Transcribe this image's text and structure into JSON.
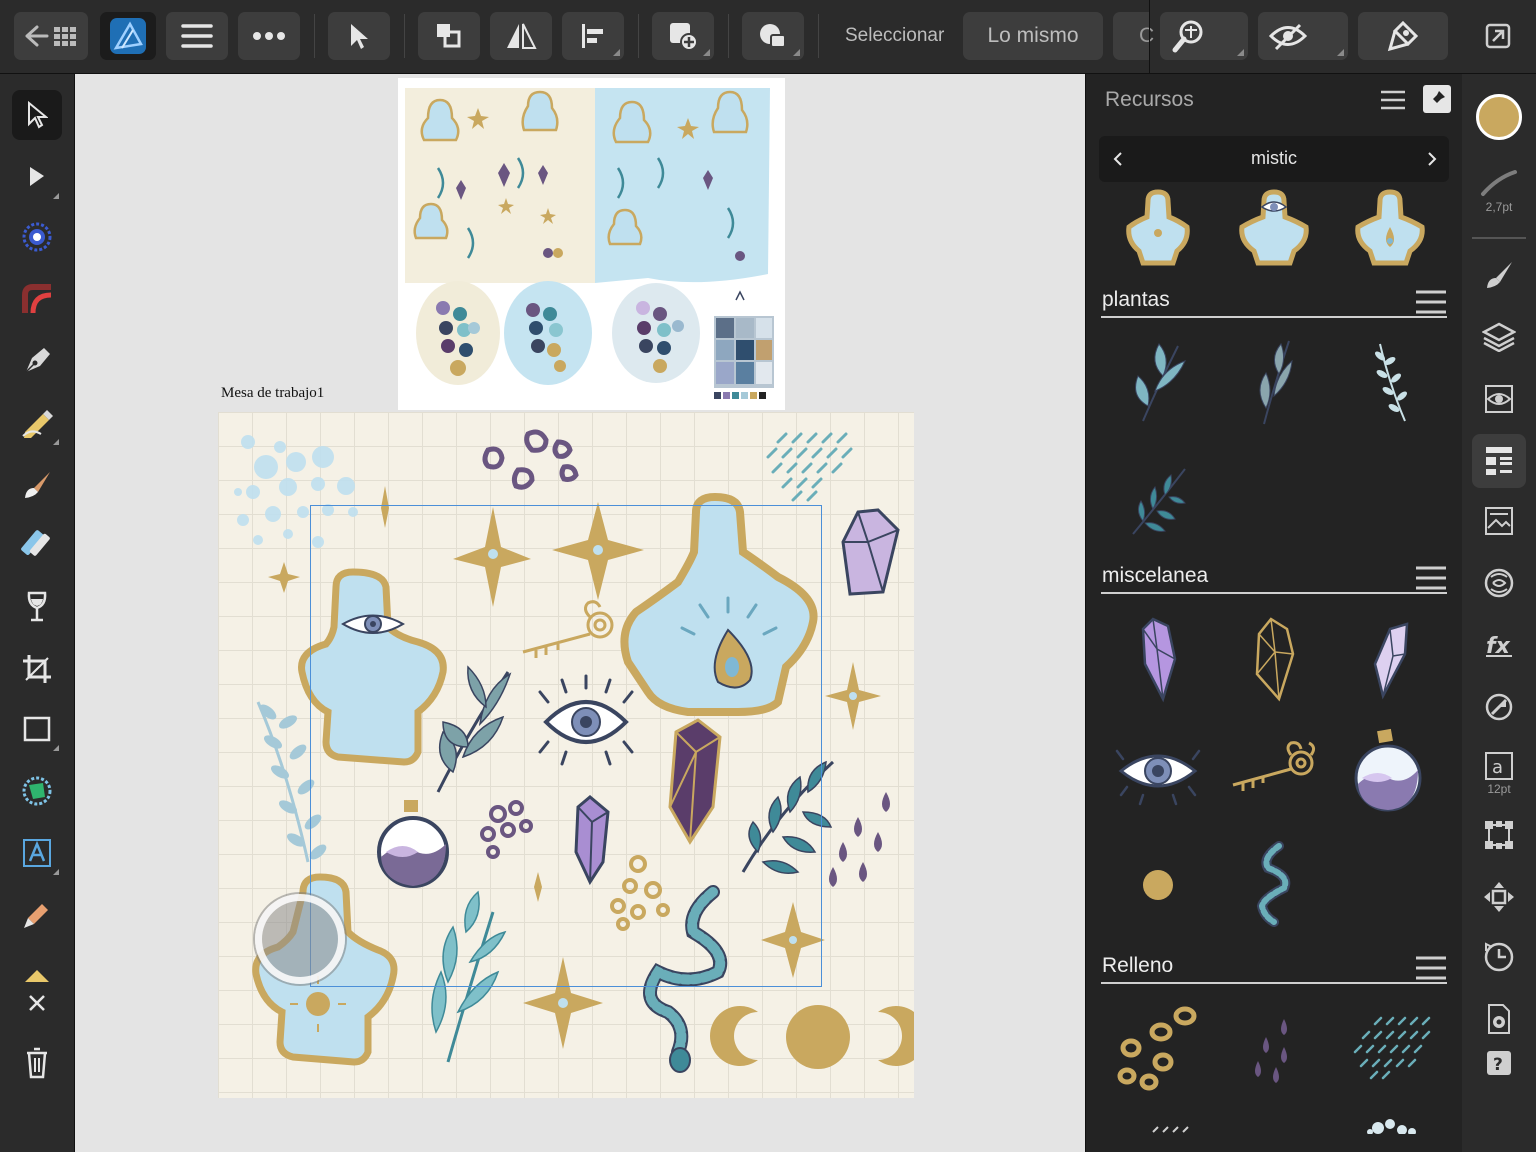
{
  "toolbar": {
    "select_label": "Seleccionar",
    "same_label": "Lo mismo",
    "cut_label": "C"
  },
  "canvas": {
    "artboard_name": "Mesa de trabajo1"
  },
  "panel": {
    "title": "Recursos",
    "category": "mistic",
    "sections": [
      {
        "label": "plantas"
      },
      {
        "label": "miscelanea"
      },
      {
        "label": "Relleno"
      }
    ]
  },
  "right_bar": {
    "stroke_width": "2,7pt",
    "text_size": "12pt",
    "color_swatch": "#c9a85f"
  },
  "colors": {
    "accent": "#1f6fb5",
    "gold": "#c9a85f",
    "light_blue": "#bfe0ef",
    "teal": "#3f8a98",
    "purple": "#6a5681",
    "lilac": "#c9b5e0",
    "selection": "#4b8fd8"
  },
  "icons": {
    "back": "arrow-left-icon",
    "grid": "grid-icon",
    "app": "affinity-designer-icon",
    "menu": "hamburger-icon",
    "more": "more-icon",
    "move": "move-tool-icon",
    "arrange": "arrange-icon",
    "flip": "flip-icon",
    "align": "align-icon",
    "insert": "insert-icon",
    "boolean": "boolean-icon",
    "snap": "snapping-icon",
    "view": "view-mode-icon",
    "assist": "assistant-icon",
    "export": "export-icon"
  }
}
